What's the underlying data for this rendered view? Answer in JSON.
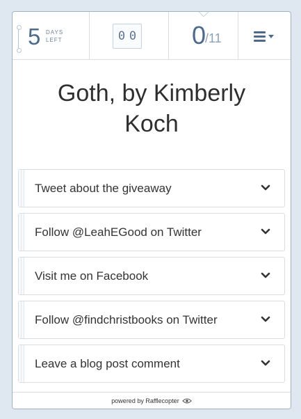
{
  "stats": {
    "days_left_value": "5",
    "days_left_line1": "DAYS",
    "days_left_line2": "LEFT",
    "your_entries": [
      "0",
      "0"
    ],
    "points_earned": "0",
    "points_total": "/11"
  },
  "menu": {
    "icon": "hamburger-menu-icon"
  },
  "title": "Goth, by Kimberly Koch",
  "entries": [
    {
      "label": "Tweet about the giveaway"
    },
    {
      "label": "Follow @LeahEGood on Twitter"
    },
    {
      "label": "Visit me on Facebook"
    },
    {
      "label": "Follow @findchristbooks on Twitter"
    },
    {
      "label": "Leave a blog post comment"
    }
  ],
  "footer": {
    "text": "powered by Rafflecopter",
    "icon": "eye-logo-icon"
  },
  "colors": {
    "accent": "#4d6a8c",
    "border": "#d7dde3",
    "background": "#dfe8f1"
  }
}
